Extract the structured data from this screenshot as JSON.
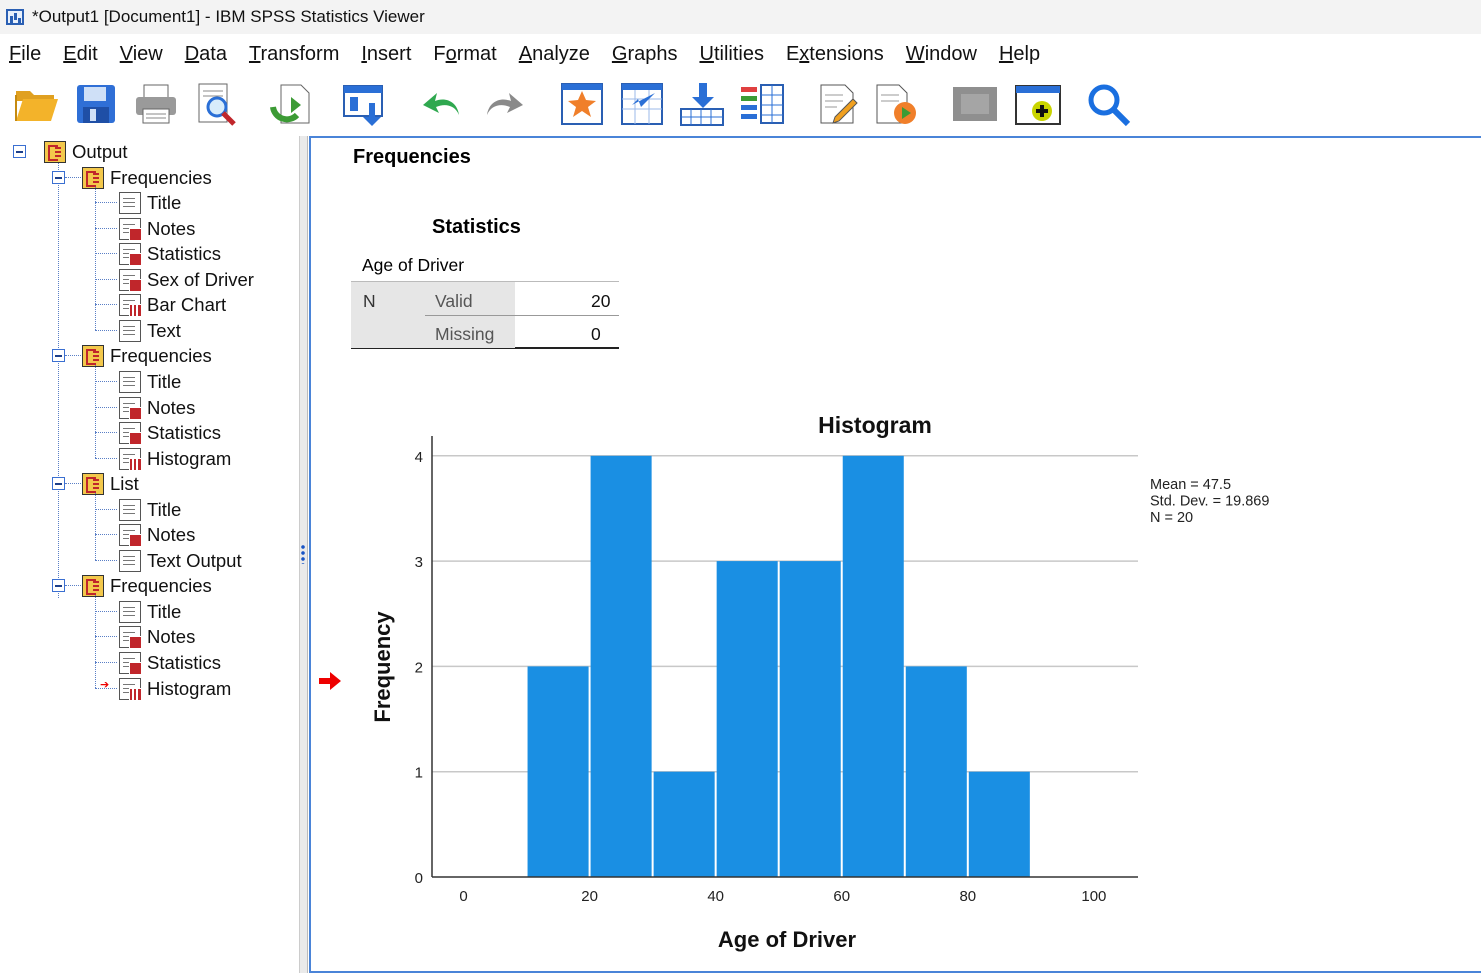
{
  "window": {
    "title": "*Output1 [Document1] - IBM SPSS Statistics Viewer"
  },
  "menu": [
    {
      "pre": "",
      "u": "F",
      "post": "ile"
    },
    {
      "pre": "",
      "u": "E",
      "post": "dit"
    },
    {
      "pre": "",
      "u": "V",
      "post": "iew"
    },
    {
      "pre": "",
      "u": "D",
      "post": "ata"
    },
    {
      "pre": "",
      "u": "T",
      "post": "ransform"
    },
    {
      "pre": "",
      "u": "I",
      "post": "nsert"
    },
    {
      "pre": "F",
      "u": "o",
      "post": "rmat"
    },
    {
      "pre": "",
      "u": "A",
      "post": "nalyze"
    },
    {
      "pre": "",
      "u": "G",
      "post": "raphs"
    },
    {
      "pre": "",
      "u": "U",
      "post": "tilities"
    },
    {
      "pre": "E",
      "u": "x",
      "post": "tensions"
    },
    {
      "pre": "",
      "u": "W",
      "post": "indow"
    },
    {
      "pre": "",
      "u": "H",
      "post": "elp"
    }
  ],
  "toolbar_icons": [
    "open-folder-icon",
    "save-icon",
    "print-icon",
    "print-preview-icon",
    "export-icon",
    "recall-dialog-icon",
    "undo-icon",
    "redo-icon",
    "goto-data-icon",
    "goto-case-icon",
    "goto-variable-icon",
    "variables-icon",
    "insert-output-icon",
    "run-script-icon",
    "designate-window-icon",
    "add-output-icon",
    "search-icon"
  ],
  "outline": {
    "root": "Output",
    "nodes": [
      {
        "label": "Frequencies",
        "level": 1
      },
      {
        "label": "Title",
        "level": 2,
        "icon": "doc"
      },
      {
        "label": "Notes",
        "level": 2,
        "icon": "doc-red"
      },
      {
        "label": "Statistics",
        "level": 2,
        "icon": "doc-red"
      },
      {
        "label": "Sex of Driver",
        "level": 2,
        "icon": "doc-red"
      },
      {
        "label": "Bar Chart",
        "level": 2,
        "icon": "doc-chart"
      },
      {
        "label": "Text",
        "level": 2,
        "icon": "doc"
      },
      {
        "label": "Frequencies",
        "level": 1
      },
      {
        "label": "Title",
        "level": 2,
        "icon": "doc"
      },
      {
        "label": "Notes",
        "level": 2,
        "icon": "doc-red"
      },
      {
        "label": "Statistics",
        "level": 2,
        "icon": "doc-red"
      },
      {
        "label": "Histogram",
        "level": 2,
        "icon": "doc-chart"
      },
      {
        "label": "List",
        "level": 1
      },
      {
        "label": "Title",
        "level": 2,
        "icon": "doc"
      },
      {
        "label": "Notes",
        "level": 2,
        "icon": "doc-red"
      },
      {
        "label": "Text Output",
        "level": 2,
        "icon": "doc"
      },
      {
        "label": "Frequencies",
        "level": 1
      },
      {
        "label": "Title",
        "level": 2,
        "icon": "doc"
      },
      {
        "label": "Notes",
        "level": 2,
        "icon": "doc-red"
      },
      {
        "label": "Statistics",
        "level": 2,
        "icon": "doc-red"
      },
      {
        "label": "Histogram",
        "level": 2,
        "icon": "doc-chart",
        "selected": true
      }
    ]
  },
  "output": {
    "heading": "Frequencies",
    "stats_title": "Statistics",
    "stats_var": "Age of Driver",
    "stats_n": "N",
    "stats_valid": "Valid",
    "stats_valid_val": "20",
    "stats_missing": "Missing",
    "stats_missing_val": "0"
  },
  "chart_data": {
    "type": "bar",
    "title": "Histogram",
    "xlabel": "Age of Driver",
    "ylabel": "Frequency",
    "bins": [
      [
        10,
        20
      ],
      [
        20,
        30
      ],
      [
        30,
        40
      ],
      [
        40,
        50
      ],
      [
        50,
        60
      ],
      [
        60,
        70
      ],
      [
        70,
        80
      ],
      [
        80,
        90
      ]
    ],
    "values": [
      2,
      4,
      1,
      3,
      3,
      4,
      2,
      1
    ],
    "xlim": [
      -5,
      107
    ],
    "ylim": [
      0,
      4.15
    ],
    "xticks": [
      0,
      20,
      40,
      60,
      80,
      100
    ],
    "yticks": [
      0,
      1,
      2,
      3,
      4
    ],
    "grid": "horizontal",
    "bar_color": "#1a8fe3",
    "stats_box": [
      "Mean = 47.5",
      "Std. Dev. = 19.869",
      "N = 20"
    ],
    "legend_position": "top-right"
  }
}
